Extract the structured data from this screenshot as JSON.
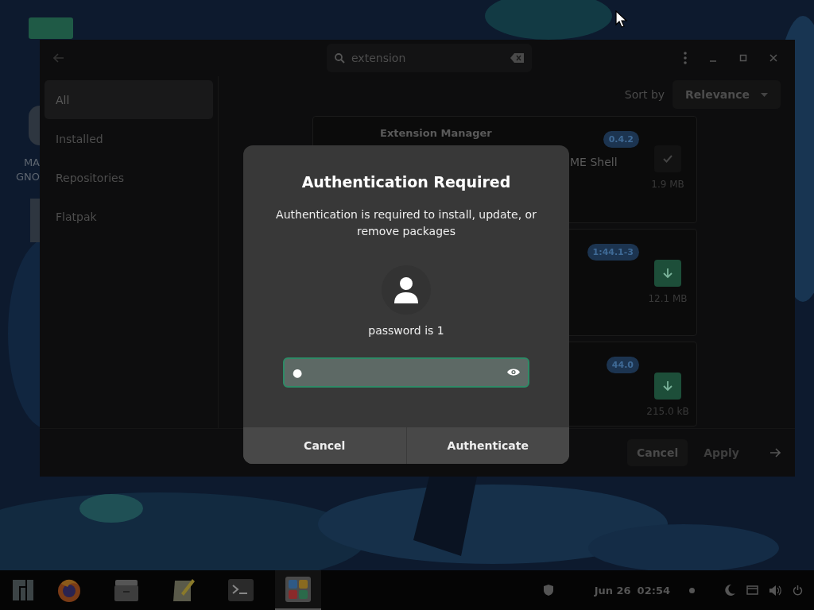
{
  "desktop_labels": [
    "MA",
    "GNO"
  ],
  "window": {
    "search": {
      "value": "extension"
    },
    "sidebar": {
      "items": [
        {
          "label": "All",
          "selected": true
        },
        {
          "label": "Installed",
          "selected": false
        },
        {
          "label": "Repositories",
          "selected": false
        },
        {
          "label": "Flatpak",
          "selected": false
        }
      ]
    },
    "sort": {
      "label": "Sort by",
      "value": "Relevance"
    },
    "results": [
      {
        "name": "Extension Manager",
        "description": "ME Shell",
        "version": "0.4.2",
        "size": "1.9 MB",
        "installed": true
      },
      {
        "version": "1:44.1-3",
        "size": "12.1 MB",
        "installed": false
      },
      {
        "version": "44.0",
        "size": "215.0 kB",
        "installed": false
      }
    ],
    "footer_buttons": [
      {
        "label": "Cancel",
        "disabled": false
      },
      {
        "label": "Apply",
        "disabled": true
      }
    ]
  },
  "dialog": {
    "title": "Authentication Required",
    "message": "Authentication is required to install, update, or remove packages",
    "user": "password is 1",
    "password": "●",
    "buttons": [
      "Cancel",
      "Authenticate"
    ]
  },
  "taskbar": {
    "apps": [
      {
        "kind": "menu",
        "selected": false
      },
      {
        "kind": "browser",
        "selected": false
      },
      {
        "kind": "files",
        "selected": false
      },
      {
        "kind": "notes",
        "selected": false
      },
      {
        "kind": "terminal",
        "selected": false
      },
      {
        "kind": "software",
        "selected": true
      }
    ],
    "date": "Jun 26",
    "time": "02:54"
  }
}
